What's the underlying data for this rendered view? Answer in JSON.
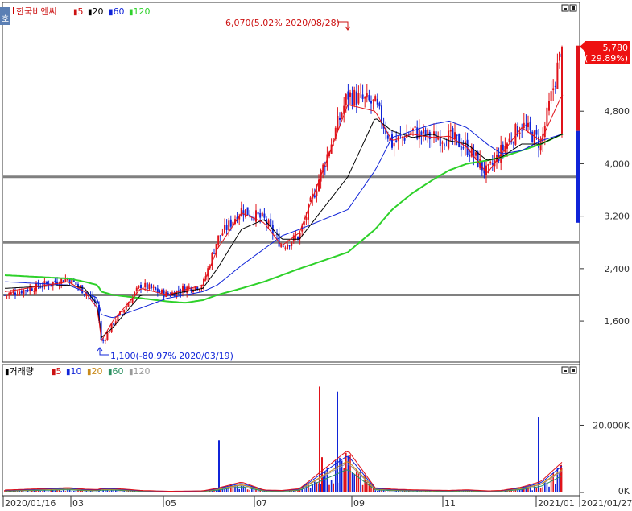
{
  "price_panel": {
    "legend": {
      "name": "한국비엔씨",
      "ma": [
        "5",
        "20",
        "60",
        "120"
      ]
    },
    "corner_label": "호",
    "price_tag": {
      "value": "5,780",
      "change": "( 29.89%)"
    },
    "high_annotation": "6,070(5.02% 2020/08/28)",
    "low_annotation": "1,100(-80.97% 2020/03/19)"
  },
  "volume_panel": {
    "legend": {
      "name": "거래량",
      "ma": [
        "5",
        "10",
        "20",
        "60",
        "120"
      ]
    }
  },
  "colors": {
    "up": "#e0131a",
    "down": "#1024d8",
    "ma5": "#e0131a",
    "ma20": "#000000",
    "ma60": "#1024d8",
    "ma120": "#2ed12a",
    "vol_ma20": "#c98a1a",
    "vol_ma60": "#2a8f60",
    "vol_ma120": "#9a9a9a",
    "hline": "#808080"
  },
  "chart_data": [
    {
      "type": "candlestick",
      "title": "한국비엔씨",
      "x_ticks": [
        "2020/01/16",
        "03",
        "05",
        "07",
        "09",
        "11",
        "2021/01",
        "2021/01/27"
      ],
      "y_ticks": [
        1600,
        2400,
        3200,
        4000,
        4800
      ],
      "y_tick_labels": [
        "1,600",
        "2,400",
        "3,200",
        "4,000",
        "4,800"
      ],
      "ylim": [
        1000,
        6250
      ],
      "horizontal_lines": [
        3800,
        2800,
        2000
      ],
      "ma_periods": [
        5,
        20,
        60,
        120
      ],
      "high": {
        "value": 6070,
        "label": "6,070(5.02% 2020/08/28)"
      },
      "low": {
        "value": 1100,
        "label": "1,100(-80.97% 2020/03/19)"
      },
      "last": {
        "value": 5780,
        "change_pct": 29.89
      },
      "x": [
        "01/16",
        "02/03",
        "02/17",
        "03/02",
        "03/19",
        "04/01",
        "04/16",
        "05/04",
        "05/19",
        "06/01",
        "06/15",
        "06/29",
        "07/13",
        "07/27",
        "08/10",
        "08/24",
        "09/07",
        "09/21",
        "10/05",
        "10/19",
        "11/02",
        "11/16",
        "11/30",
        "12/14",
        "12/28",
        "01/11",
        "01/27"
      ],
      "close": [
        2000,
        2250,
        2050,
        1850,
        1250,
        1550,
        2150,
        2000,
        2100,
        2150,
        2850,
        3300,
        3150,
        2750,
        2900,
        5050,
        4900,
        4300,
        4500,
        4400,
        4400,
        4250,
        3850,
        4200,
        4600,
        4300,
        5780
      ],
      "ma5": [
        2050,
        2200,
        2050,
        1800,
        1300,
        1600,
        2100,
        2000,
        2080,
        2150,
        2700,
        3250,
        3100,
        2750,
        2950,
        4900,
        4800,
        4350,
        4450,
        4400,
        4420,
        4250,
        3850,
        4150,
        4550,
        4350,
        5050
      ],
      "ma20": [
        2100,
        2150,
        2100,
        1850,
        1350,
        1500,
        2000,
        2000,
        2050,
        2100,
        2400,
        3000,
        3150,
        2850,
        2850,
        3800,
        4700,
        4500,
        4400,
        4450,
        4350,
        4300,
        4050,
        4100,
        4300,
        4300,
        4450
      ],
      "ma60": [
        2200,
        2150,
        2050,
        1950,
        1700,
        1650,
        1800,
        1950,
        2000,
        2050,
        2150,
        2450,
        2700,
        2900,
        3000,
        3300,
        3900,
        4400,
        4500,
        4600,
        4650,
        4550,
        4300,
        4150,
        4200,
        4350,
        4450
      ],
      "ma120": [
        2300,
        2250,
        2200,
        2150,
        2050,
        2000,
        1950,
        1900,
        1880,
        1920,
        2000,
        2100,
        2200,
        2300,
        2400,
        2650,
        3000,
        3300,
        3550,
        3750,
        3900,
        4000,
        4050,
        4100,
        4200,
        4300,
        4450
      ]
    },
    {
      "type": "bar",
      "title": "거래량",
      "y_ticks": [
        0,
        20000
      ],
      "y_tick_labels": [
        "0K",
        "20,000K"
      ],
      "ylim": [
        0,
        34000
      ],
      "x": [
        "01/16",
        "02/03",
        "02/17",
        "03/02",
        "03/19",
        "04/01",
        "04/16",
        "05/04",
        "05/19",
        "06/01",
        "06/15",
        "06/29",
        "07/13",
        "07/27",
        "08/10",
        "08/24",
        "09/07",
        "09/21",
        "10/05",
        "10/19",
        "11/02",
        "11/16",
        "11/30",
        "12/14",
        "12/28",
        "01/11",
        "01/27"
      ],
      "values": [
        1800,
        3600,
        2500,
        2200,
        3000,
        3200,
        1500,
        900,
        1000,
        1200,
        3200,
        7800,
        1800,
        1500,
        2800,
        31500,
        3500,
        2500,
        2000,
        1700,
        1500,
        2000,
        1200,
        1500,
        4000,
        8200,
        22500
      ],
      "spikes": [
        {
          "x": "06/29",
          "value": 15500
        },
        {
          "x": "08/10",
          "value": 10500
        },
        {
          "x": "08/20",
          "value": 30000
        },
        {
          "x": "08/28",
          "value": 31500
        },
        {
          "x": "01/11",
          "value": 22500
        },
        {
          "x": "01/27",
          "value": 8200
        }
      ]
    }
  ]
}
